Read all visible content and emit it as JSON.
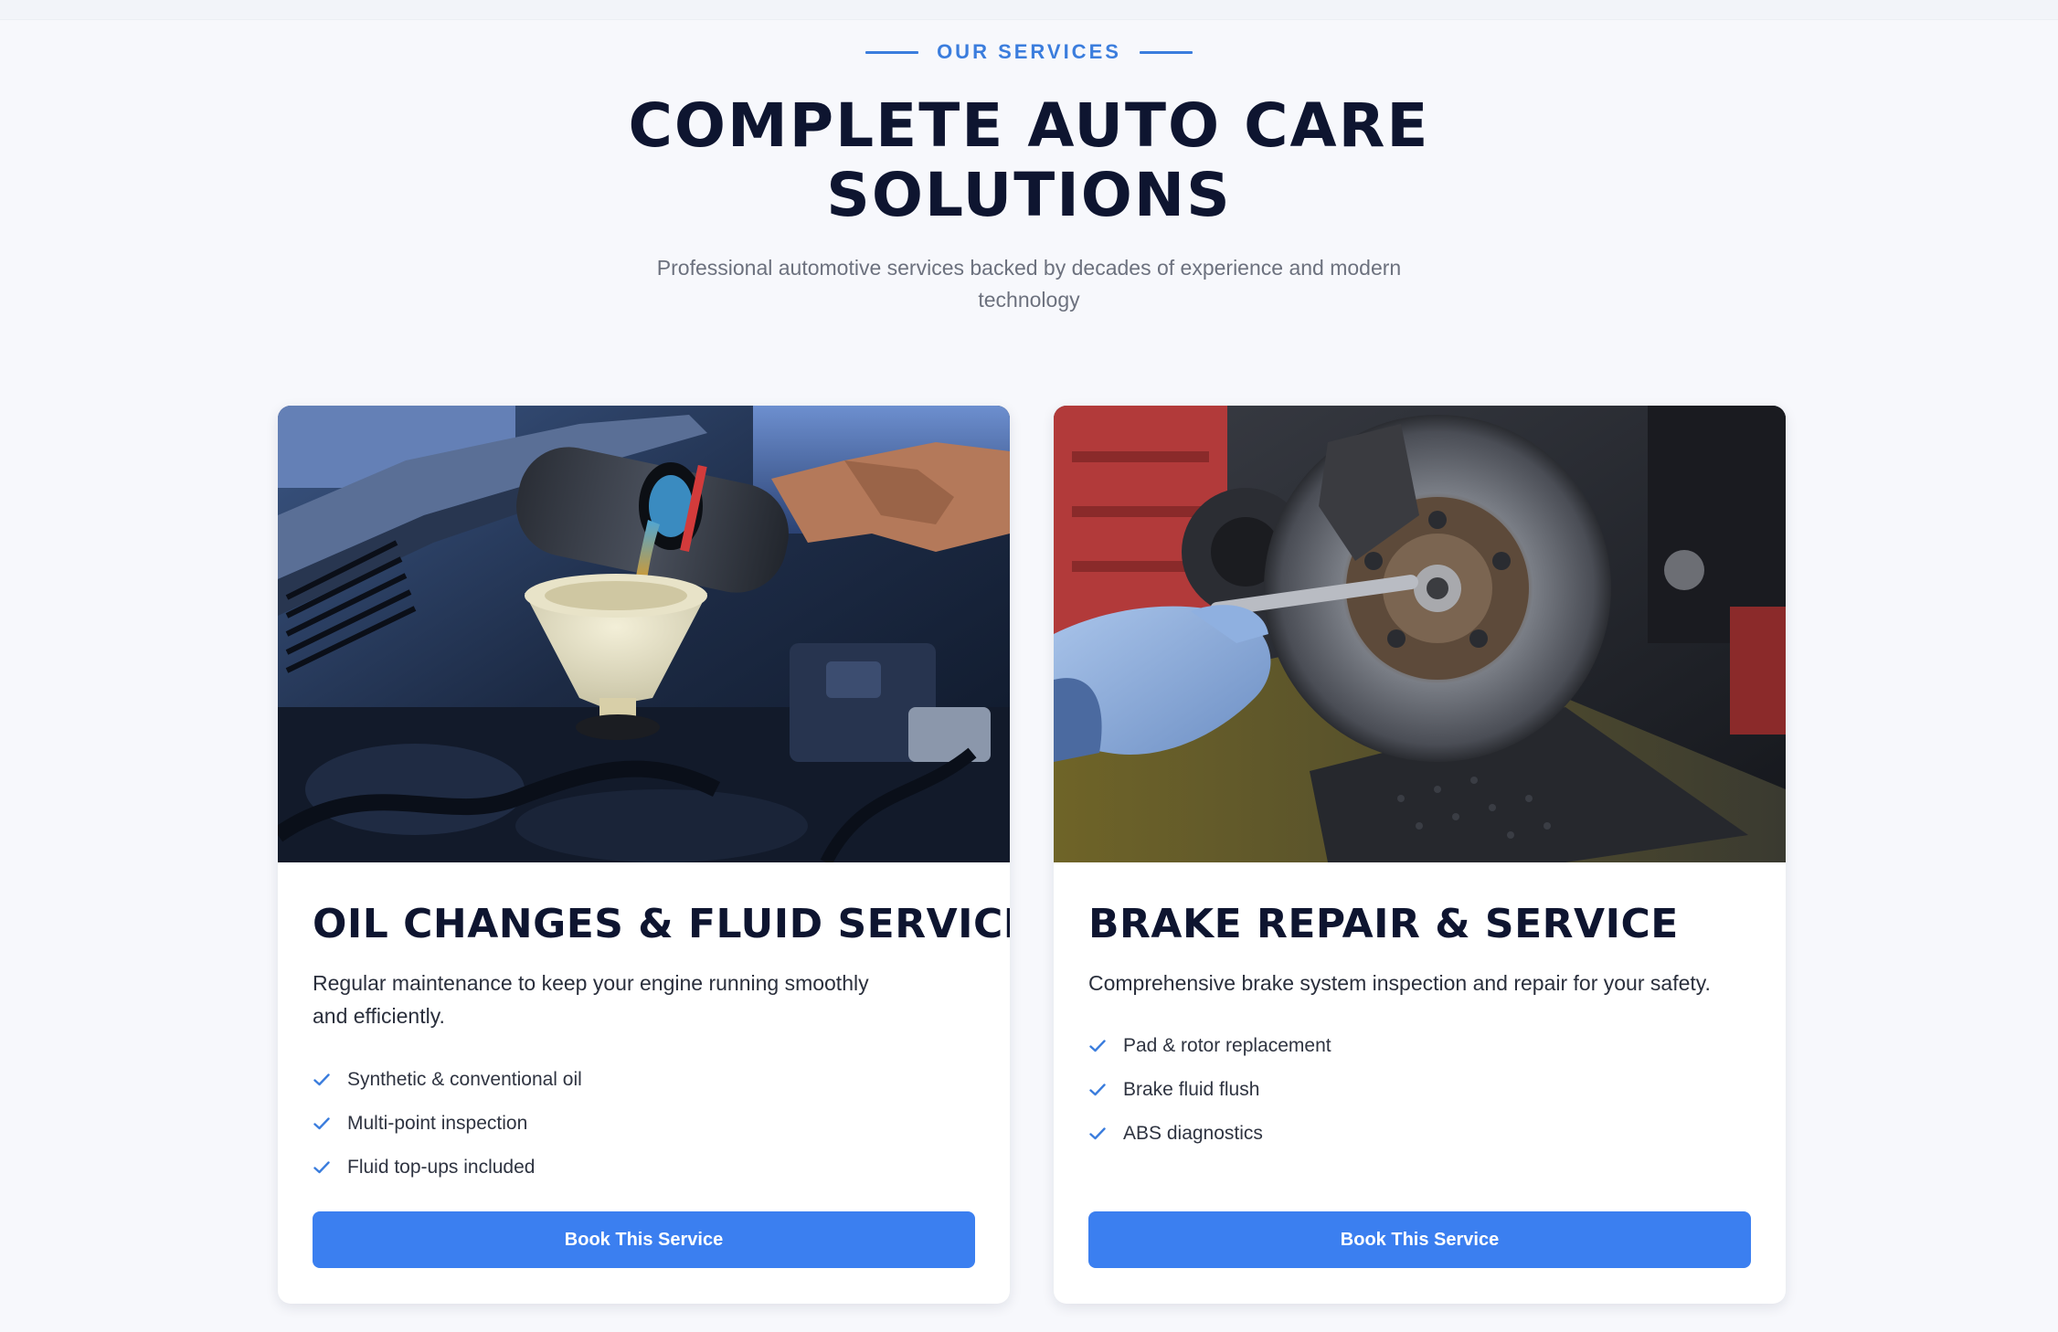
{
  "section": {
    "eyebrow": "OUR SERVICES",
    "title_line1": "COMPLETE AUTO CARE",
    "title_line2": "SOLUTIONS",
    "subtitle": "Professional automotive services backed by decades of experience and modern technology"
  },
  "colors": {
    "accent": "#3b7ff0",
    "heading": "#0e1530",
    "background": "#f7f8fc"
  },
  "services": [
    {
      "title": "OIL CHANGES & FLUID SERVICE",
      "description": "Regular maintenance to keep your engine running smoothly and efficiently.",
      "features": [
        "Synthetic & conventional oil",
        "Multi-point inspection",
        "Fluid top-ups included"
      ],
      "button_label": "Book This Service",
      "image_alt": "Mechanic pouring oil through a funnel into an engine"
    },
    {
      "title": "BRAKE REPAIR & SERVICE",
      "description": "Comprehensive brake system inspection and repair for your safety.",
      "features": [
        "Pad & rotor replacement",
        "Brake fluid flush",
        "ABS diagnostics"
      ],
      "button_label": "Book This Service",
      "image_alt": "Gloved hand servicing a brake rotor and caliper"
    }
  ]
}
